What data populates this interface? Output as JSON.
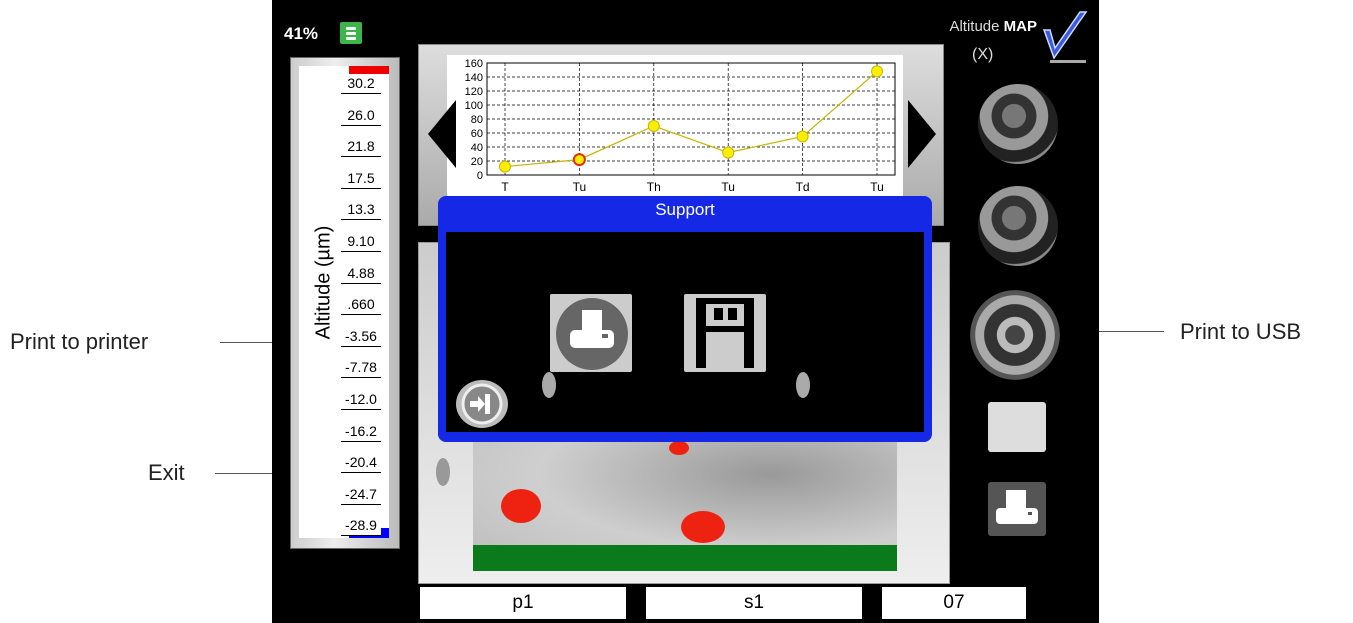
{
  "callouts": {
    "print_printer": "Print  to printer",
    "print_usb": "Print to USB",
    "exit": "Exit"
  },
  "status": {
    "battery": "41%"
  },
  "header": {
    "title_prefix": "Altitude",
    "title_main": "MAP",
    "axis": "(X)"
  },
  "scale": {
    "label": "Altitude (µm)",
    "ticks": [
      "30.2",
      "26.0",
      "21.8",
      "17.5",
      "13.3",
      "9.10",
      "4.88",
      ".660",
      "-3.56",
      "-7.78",
      "-12.0",
      "-16.2",
      "-20.4",
      "-24.7",
      "-28.9"
    ]
  },
  "chart_data": {
    "type": "line",
    "categories": [
      "T",
      "Tu",
      "Th",
      "Tu",
      "Td",
      "Tu"
    ],
    "values": [
      12,
      22,
      70,
      32,
      55,
      148
    ],
    "ylim": [
      0,
      160
    ],
    "yticks": [
      0,
      20,
      40,
      60,
      80,
      100,
      120,
      140,
      160
    ],
    "grid": true,
    "colors": {
      "line": "#c8b400",
      "point": "#ffee00",
      "highlight": "#e03010"
    }
  },
  "dialog": {
    "title": "Support"
  },
  "fields": {
    "p": "p1",
    "s": "s1",
    "n": "07"
  },
  "icons": {
    "check": "check-icon",
    "database": "database-icon",
    "camera": "camera-icon",
    "gear": "gear-icon",
    "printer": "printer-icon",
    "usb": "usb-icon",
    "exit": "exit-icon"
  }
}
